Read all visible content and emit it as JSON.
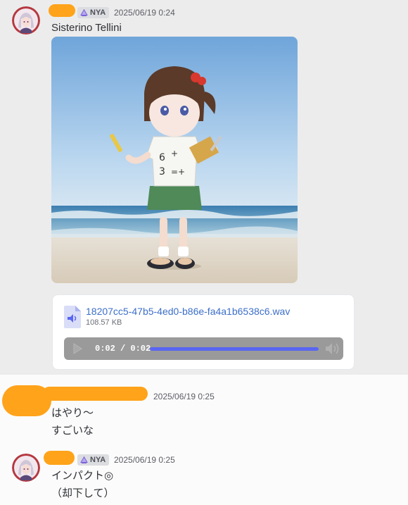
{
  "messages": [
    {
      "tag": "NYA",
      "timestamp": "2025/06/19 0:24",
      "lines": [
        "Sisterino Tellini"
      ],
      "attachment_file": {
        "name": "18207cc5-47b5-4ed0-b86e-fa4a1b6538c6.wav",
        "size": "108.57 KB",
        "player_time": "0:02 / 0:02",
        "progress": 1.0
      }
    },
    {
      "timestamp": "2025/06/19 0:25",
      "lines": [
        "はやり〜",
        "すごいな"
      ]
    },
    {
      "tag": "NYA",
      "timestamp": "2025/06/19 0:25",
      "lines": [
        "インパクト◎",
        "（却下して）"
      ]
    }
  ],
  "colors": {
    "redaction": "#ffa31a",
    "link": "#3c6fc9",
    "accent": "#5865f2"
  },
  "icons": [
    "user-avatar",
    "server-tag-icon",
    "audio-file-icon",
    "play-icon",
    "volume-icon"
  ]
}
